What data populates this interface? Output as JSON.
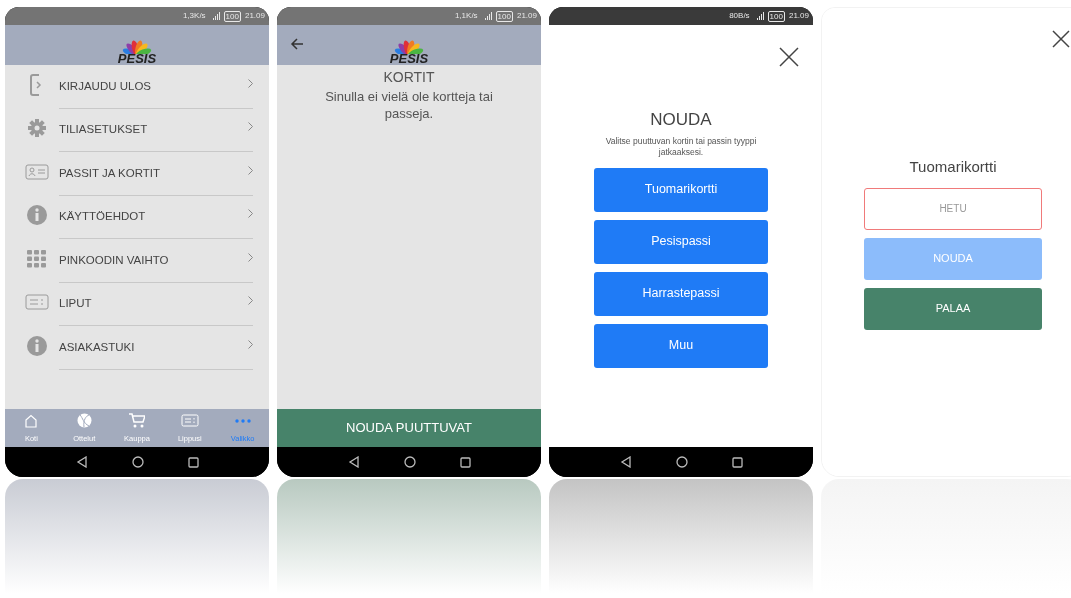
{
  "screens": [
    {
      "kind": "menu",
      "status_bar": {
        "speed": "1,3K/s",
        "battery": "100",
        "time": "21.09"
      },
      "logo": "PESIS",
      "back": false,
      "menu_items": [
        {
          "kind": "logout",
          "label": "KIRJAUDU ULOS"
        },
        {
          "kind": "settings",
          "label": "TILIASETUKSET"
        },
        {
          "kind": "card",
          "label": "PASSIT JA KORTIT"
        },
        {
          "kind": "info",
          "label": "KÄYTTÖEHDOT"
        },
        {
          "kind": "keypad",
          "label": "PINKOODIN VAIHTO"
        },
        {
          "kind": "ticket",
          "label": "LIPUT"
        },
        {
          "kind": "info",
          "label": "ASIAKASTUKI"
        }
      ],
      "tabs": [
        {
          "kind": "home",
          "label": "Koti",
          "selected": false
        },
        {
          "kind": "ball",
          "label": "Ottelut",
          "selected": false
        },
        {
          "kind": "cart",
          "label": "Kauppa",
          "selected": false
        },
        {
          "kind": "ticket",
          "label": "Lippusi",
          "selected": false
        },
        {
          "kind": "more",
          "label": "Valikko",
          "selected": true
        }
      ]
    },
    {
      "kind": "cards",
      "status_bar": {
        "speed": "1,1K/s",
        "battery": "100",
        "time": "21.09"
      },
      "logo": "PESIS",
      "back": true,
      "title": "KORTIT",
      "message": "Sinulla ei vielä ole kortteja tai passeja.",
      "action": "NOUDA PUUTTUVAT"
    },
    {
      "kind": "choose",
      "status_bar": {
        "speed": "80B/s",
        "battery": "100",
        "time": "21.09"
      },
      "title": "NOUDA",
      "subtitle": "Valitse puuttuvan kortin tai passin tyyppi jatkaaksesi.",
      "options": [
        "Tuomarikortti",
        "Pesispassi",
        "Harrastepassi",
        "Muu"
      ]
    },
    {
      "kind": "form",
      "title": "Tuomarikortti",
      "field": {
        "placeholder": "HETU",
        "invalid": true
      },
      "buttons": [
        {
          "kind": "submit",
          "label": "NOUDA",
          "disabled": true
        },
        {
          "kind": "back",
          "label": "PALAA",
          "disabled": false
        }
      ]
    }
  ]
}
